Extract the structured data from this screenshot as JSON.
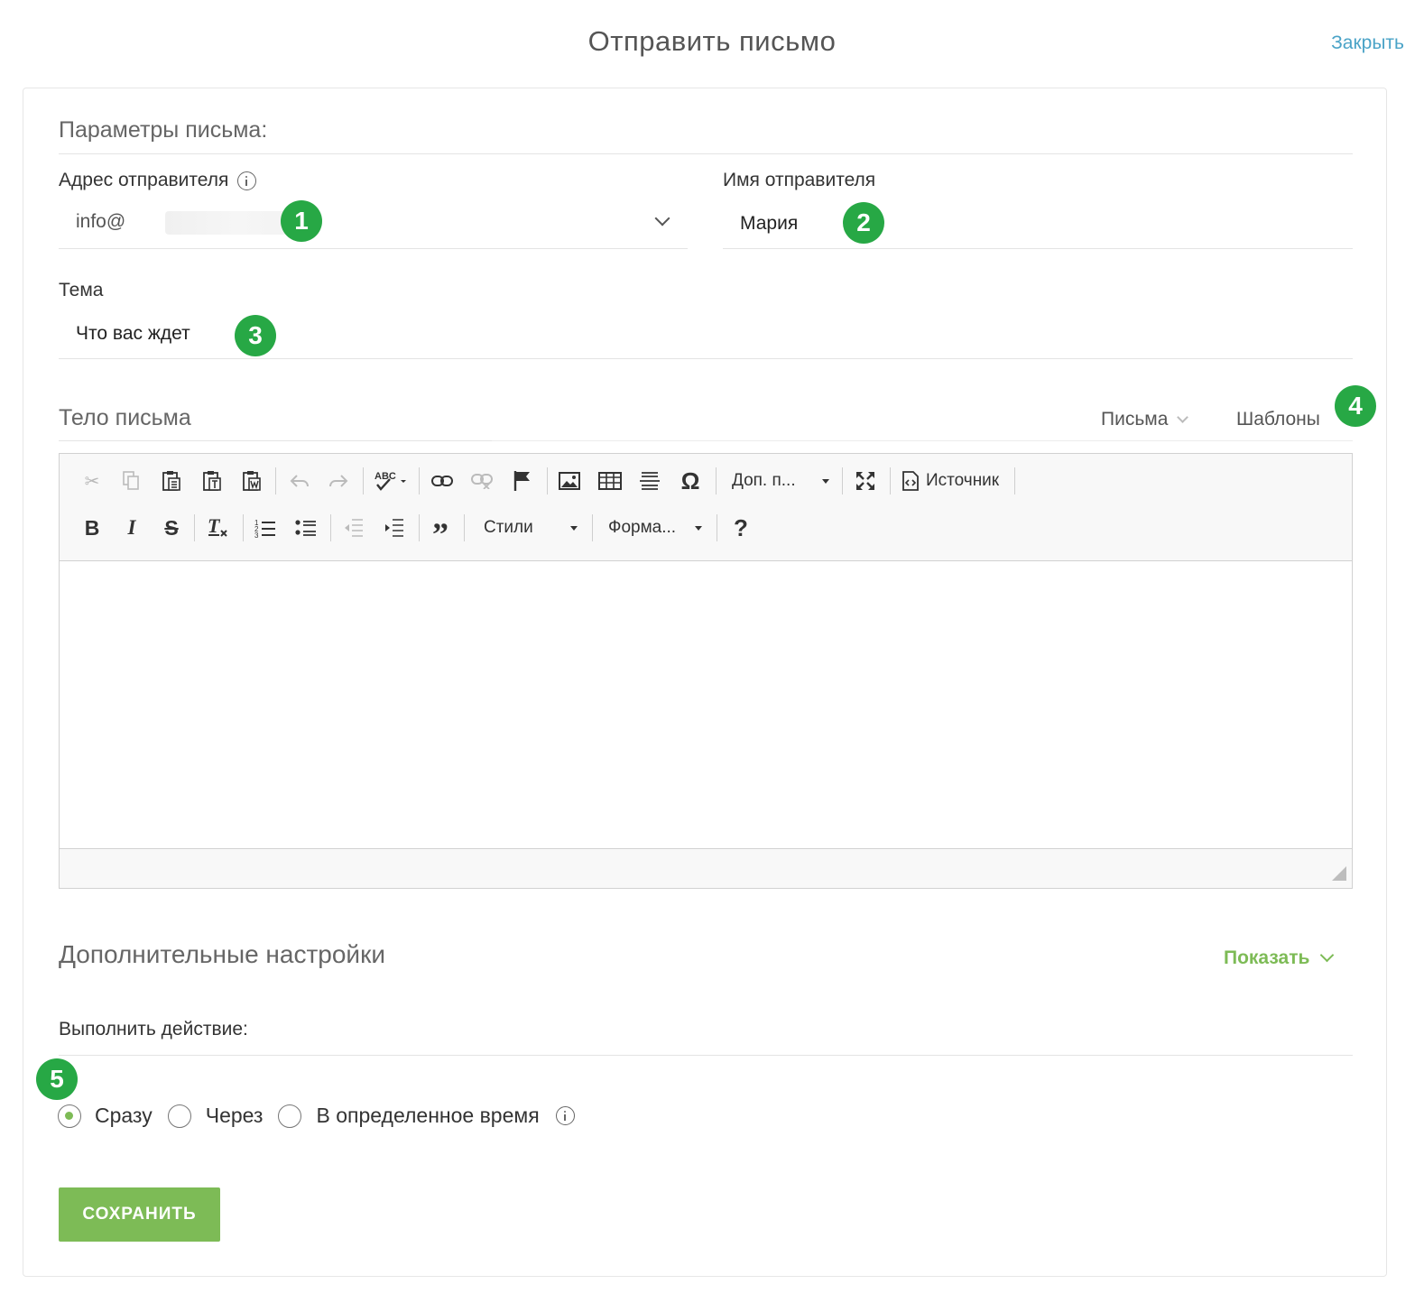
{
  "header": {
    "title": "Отправить письмо",
    "close_label": "Закрыть"
  },
  "params": {
    "section_title": "Параметры письма:",
    "sender_address_label": "Адрес отправителя",
    "sender_address_value": "info@",
    "sender_name_label": "Имя отправителя",
    "sender_name_value": "Мария",
    "subject_label": "Тема",
    "subject_value": "Что вас ждет"
  },
  "body_section": {
    "title": "Тело письма",
    "letters_label": "Письма",
    "templates_label": "Шаблоны"
  },
  "toolbar": {
    "extra_label": "Доп. п...",
    "source_label": "Источник",
    "styles_label": "Стили",
    "format_label": "Форма..."
  },
  "advanced": {
    "title": "Дополнительные настройки",
    "show_label": "Показать"
  },
  "action": {
    "label": "Выполнить действие:",
    "options": [
      "Сразу",
      "Через",
      "В определенное время"
    ],
    "selected": "Сразу"
  },
  "save_label": "Сохранить",
  "badges": [
    "1",
    "2",
    "3",
    "4",
    "5"
  ],
  "colors": {
    "accent_green": "#7dbb56",
    "badge_green": "#27a845",
    "link_blue": "#4aa3c7"
  }
}
